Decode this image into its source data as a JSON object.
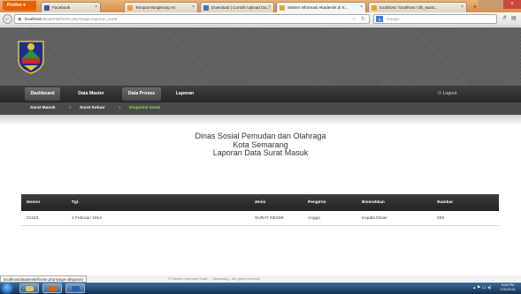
{
  "browser": {
    "firefox_label": "Firefox",
    "tabs": [
      {
        "label": "Facebook",
        "color": "#3b5998"
      },
      {
        "label": "Tempat Nongkrong An",
        "color": "#e9a23b"
      },
      {
        "label": "Download | Contoh Upload Ga...",
        "color": "#3b78c6"
      },
      {
        "label": "Sistem Informasi Akademik di S...",
        "color": "#e9a23b"
      },
      {
        "label": "localhost / localhost / db_surat...",
        "color": "#f0a030"
      }
    ],
    "url_host": "localhost",
    "url_path": "/akademik/home.php?page=laporan_surat",
    "search_placeholder": "Google",
    "status_url": "localhost/akademik/home.php?page=disposisi"
  },
  "nav": {
    "items": [
      "Dashboard",
      "Data Master",
      "Data Proses",
      "Laporan"
    ],
    "logout": "Logout"
  },
  "breadcrumb": {
    "item1": "Surat Masuk",
    "sep": "»",
    "item2": "Surat Keluar",
    "item3": "Disposisi Surat"
  },
  "report": {
    "line1": "Dinas Sosial Pemudan dan Olahraga",
    "line2": "Kota Semarang",
    "line3": "Laporan Data Surat Masuk"
  },
  "table": {
    "headers": [
      "Nomor",
      "Tgl. Surat",
      "Jenis Surat",
      "Pengirim",
      "Diserahkan",
      "Gambar"
    ],
    "rows": [
      [
        "21323",
        "1 Februari 2014",
        "SURAT RESMI",
        "Angga",
        "Kepala Dinas",
        "839"
      ]
    ]
  },
  "footer": "© Sistem Informasi Surat ... Semarang - All rights reserved",
  "clock": {
    "time": "8:45 PM",
    "date": "1/31/2014"
  },
  "colors": {
    "active_breadcrumb": "#a6d64b",
    "nav_bg": "#2e2e2e"
  }
}
